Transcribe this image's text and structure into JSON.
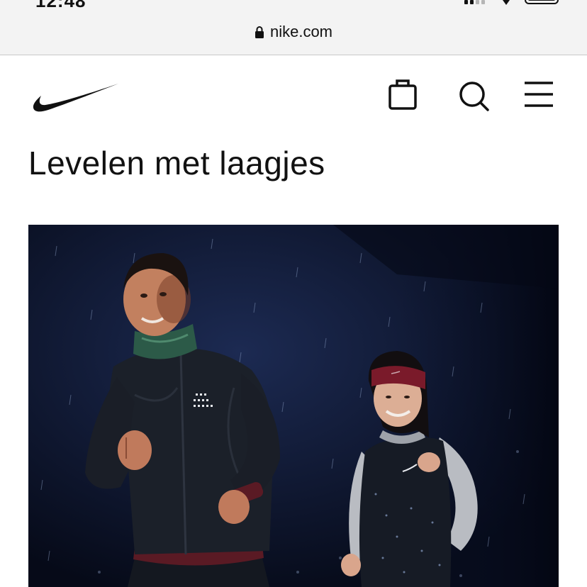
{
  "status_bar": {
    "time": "12:48",
    "signal_bars": 2,
    "signal_total": 4
  },
  "browser": {
    "url": "nike.com",
    "lock_icon": "lock-icon"
  },
  "header": {
    "logo_icon": "swoosh-logo-icon",
    "actions": [
      {
        "name": "bag-button",
        "icon": "shopping-bag-icon"
      },
      {
        "name": "search-button",
        "icon": "search-icon"
      },
      {
        "name": "menu-button",
        "icon": "hamburger-menu-icon"
      }
    ]
  },
  "main": {
    "title": "Levelen met laagjes"
  },
  "hero_image": {
    "scene": "two runners in the rain at night",
    "colors": {
      "background": "#0b1228",
      "jacket": "#1b1f25",
      "headband": "#7a1a2a",
      "sleeve": "#b9bcc2"
    }
  },
  "theme": {
    "text": "#111111",
    "browser_bar": "#f3f3f3"
  }
}
